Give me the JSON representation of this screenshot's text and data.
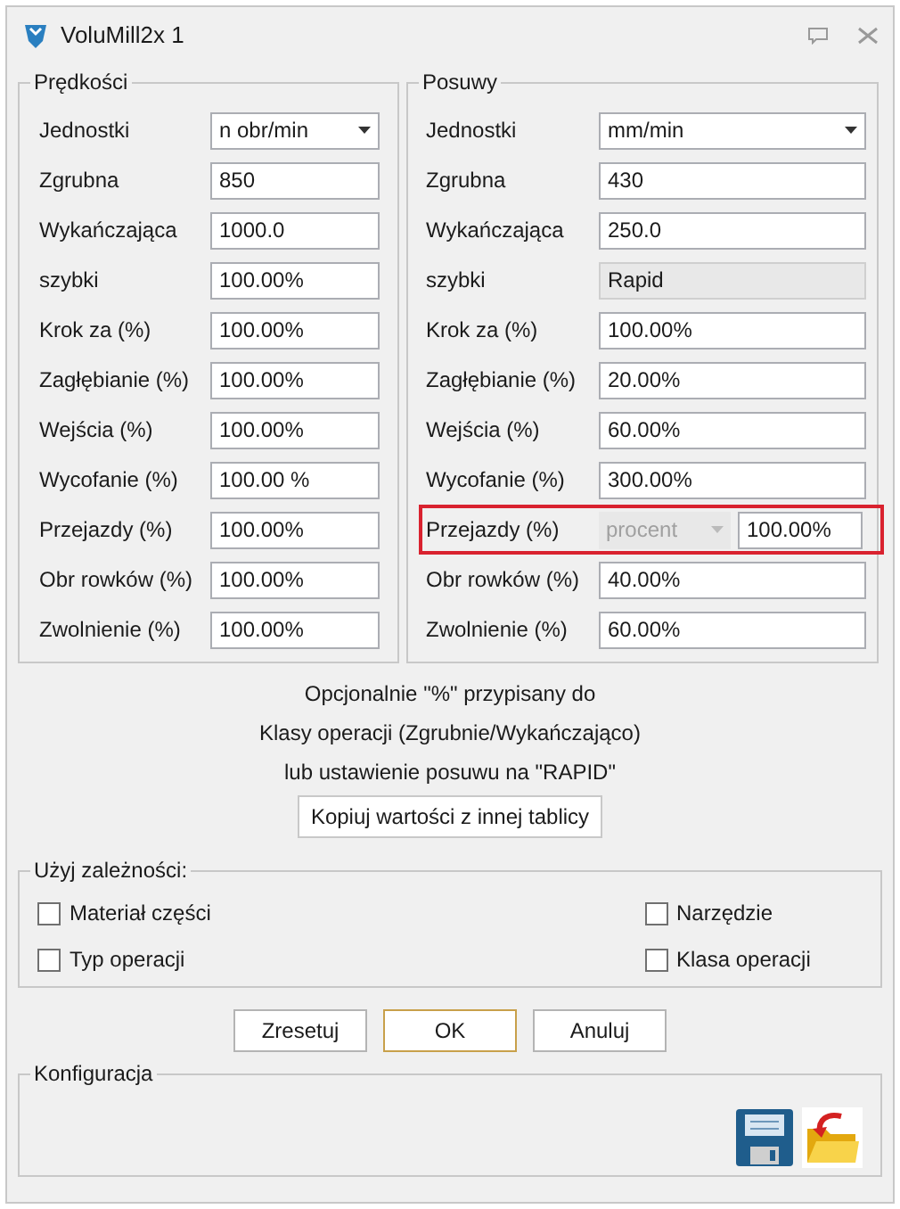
{
  "window": {
    "title": "VoluMill2x 1"
  },
  "groups": [
    {
      "title": "Prędkości",
      "rows": [
        {
          "label": "Jednostki",
          "kind": "select",
          "value": "n obr/min"
        },
        {
          "label": "Zgrubna",
          "kind": "input",
          "value": "850"
        },
        {
          "label": "Wykańczająca",
          "kind": "input",
          "value": "1000.0"
        },
        {
          "label": "szybki",
          "kind": "input",
          "value": "100.00%"
        },
        {
          "label": "Krok za (%)",
          "kind": "input",
          "value": "100.00%"
        },
        {
          "label": "Zagłębianie (%)",
          "kind": "input",
          "value": "100.00%"
        },
        {
          "label": "Wejścia (%)",
          "kind": "input",
          "value": "100.00%"
        },
        {
          "label": "Wycofanie (%)",
          "kind": "input",
          "value": "100.00 %"
        },
        {
          "label": "Przejazdy (%)",
          "kind": "input",
          "value": "100.00%"
        },
        {
          "label": "Obr rowków (%)",
          "kind": "input",
          "value": "100.00%"
        },
        {
          "label": "Zwolnienie (%)",
          "kind": "input",
          "value": "100.00%"
        }
      ]
    },
    {
      "title": "Posuwy",
      "rows": [
        {
          "label": "Jednostki",
          "kind": "select",
          "value": "mm/min"
        },
        {
          "label": "Zgrubna",
          "kind": "input",
          "value": "430"
        },
        {
          "label": "Wykańczająca",
          "kind": "input",
          "value": "250.0"
        },
        {
          "label": "szybki",
          "kind": "readonly",
          "value": "Rapid"
        },
        {
          "label": "Krok za (%)",
          "kind": "input",
          "value": "100.00%"
        },
        {
          "label": "Zagłębianie (%)",
          "kind": "input",
          "value": "20.00%"
        },
        {
          "label": "Wejścia (%)",
          "kind": "input",
          "value": "60.00%"
        },
        {
          "label": "Wycofanie (%)",
          "kind": "input",
          "value": "300.00%"
        },
        {
          "label": "Przejazdy (%)",
          "kind": "combo",
          "option": "procent",
          "value": "100.00%",
          "highlighted": true
        },
        {
          "label": "Obr rowków (%)",
          "kind": "input",
          "value": "40.00%"
        },
        {
          "label": "Zwolnienie (%)",
          "kind": "input",
          "value": "60.00%"
        }
      ]
    }
  ],
  "notes": [
    "Opcjonalnie \"%\" przypisany do",
    "Klasy operacji (Zgrubnie/Wykańczająco)",
    "lub ustawienie posuwu na \"RAPID\""
  ],
  "copy_button": "Kopiuj wartości z innej tablicy",
  "dependencies": {
    "title": "Użyj zależności:",
    "options": [
      {
        "label": "Materiał części",
        "checked": false
      },
      {
        "label": "Narzędzie",
        "checked": false
      },
      {
        "label": "Typ operacji",
        "checked": false
      },
      {
        "label": "Klasa operacji",
        "checked": false
      }
    ]
  },
  "buttons": [
    {
      "label": "Zresetuj",
      "selected": false
    },
    {
      "label": "OK",
      "selected": true
    },
    {
      "label": "Anuluj",
      "selected": false
    }
  ],
  "config": {
    "title": "Konfiguracja"
  }
}
